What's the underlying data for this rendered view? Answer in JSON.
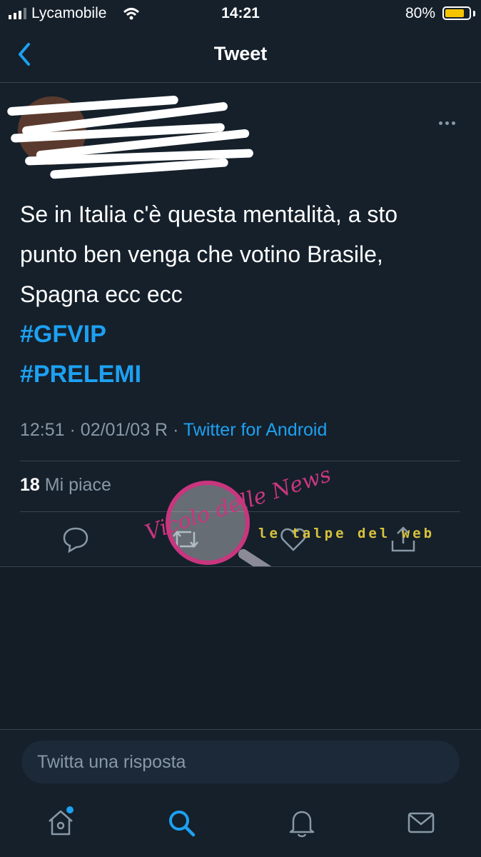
{
  "status_bar": {
    "carrier": "Lycamobile",
    "time": "14:21",
    "battery": "80%",
    "battery_level": 0.8
  },
  "nav": {
    "title": "Tweet"
  },
  "tweet": {
    "text_lines": [
      "Se in Italia c'è questa mentalità, a sto",
      "punto ben venga che votino Brasile,",
      "Spagna ecc ecc"
    ],
    "hashtags": [
      "#GFVIP",
      "#PRELEMI"
    ],
    "time": "12:51",
    "date": "02/01/03 R",
    "separator": "·",
    "source": "Twitter for Android",
    "likes_count": "18",
    "likes_label": "Mi piace"
  },
  "reply": {
    "placeholder": "Twitta una risposta"
  },
  "watermark": {
    "script": "Vicolo delle News",
    "text": "le talpe del web"
  },
  "colors": {
    "background": "#15202b",
    "accent": "#1da1f2",
    "secondary_text": "#8899a6",
    "divider": "#38444d"
  }
}
